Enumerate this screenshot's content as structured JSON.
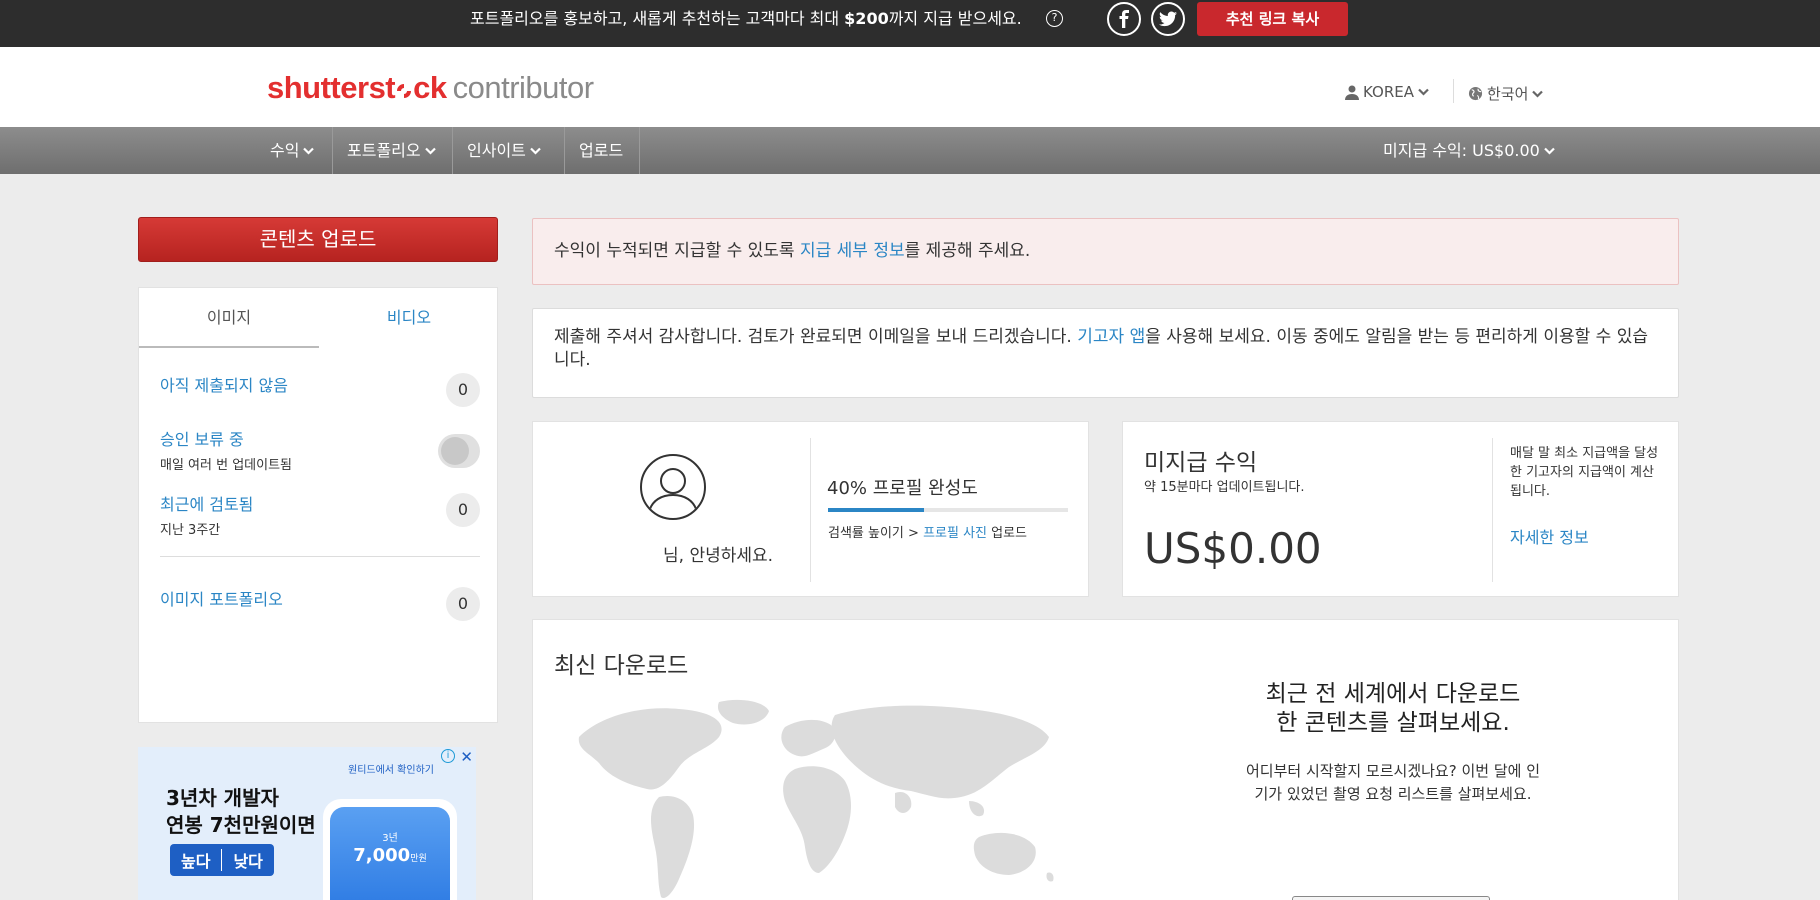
{
  "promo": {
    "text_before": "포트폴리오를 홍보하고, 새롭게 추천하는 고객마다 최대 ",
    "amount": "$200",
    "text_after": "까지 지급 받으세요.",
    "help": "?",
    "copy_button": "추천 링크 복사"
  },
  "header": {
    "logo_brand_1": "shutterst",
    "logo_brand_2": "ck",
    "logo_suffix": "contributor",
    "account": "KOREA",
    "language": "한국어"
  },
  "nav": {
    "items": [
      {
        "label": "수익"
      },
      {
        "label": "포트폴리오"
      },
      {
        "label": "인사이트"
      },
      {
        "label": "업로드"
      }
    ],
    "unpaid": "미지급 수익: US$0.00"
  },
  "sidebar": {
    "upload_button": "콘텐츠 업로드",
    "tabs": [
      "이미지",
      "비디오"
    ],
    "statuses": [
      {
        "title": "아직 제출되지 않음",
        "sub": "",
        "count": "0"
      },
      {
        "title": "승인 보류 중",
        "sub": "매일 여러 번 업데이트됨",
        "count": ""
      },
      {
        "title": "최근에 검토됨",
        "sub": "지난 3주간",
        "count": "0"
      },
      {
        "title": "이미지 포트폴리오",
        "sub": "",
        "count": "0"
      }
    ]
  },
  "ad": {
    "headline_1": "3년차 개발자",
    "headline_2": "연봉 7천만원이면",
    "btn_high": "높다",
    "btn_low": "낮다",
    "top_label": "원티드에서 확인하기",
    "screen_label": "3년",
    "screen_value": "7,000",
    "screen_unit": "만원",
    "info": "i",
    "close": "✕"
  },
  "alerts": {
    "payout_before": "수익이 누적되면 지급할 수 있도록 ",
    "payout_link": "지급 세부 정보",
    "payout_after": "를 제공해 주세요.",
    "thanks_before": "제출해 주셔서 감사합니다. 검토가 완료되면 이메일을 보내 드리겠습니다. ",
    "thanks_link": "기고자 앱",
    "thanks_after": "을 사용해 보세요. 이동 중에도 알림을 받는 등 편리하게 이용할 수 있습니다."
  },
  "profile": {
    "greeting": "님, 안녕하세요.",
    "completion": "40% 프로필 완성도",
    "completion_value": 0.4,
    "hint_before": "검색률 높이기 > ",
    "hint_link": "프로필 사진",
    "hint_after": " 업로드"
  },
  "earnings": {
    "title": "미지급 수익",
    "subtitle": "약 15분마다 업데이트됩니다.",
    "amount": "US$0.00",
    "note": "매달 말 최소 지급액을 달성한 기고자의 지급액이 계산됩니다.",
    "more_link": "자세한 정보"
  },
  "downloads": {
    "title": "최신 다운로드",
    "heading_1": "최근 전 세계에서 다운로드",
    "heading_2": "한 콘텐츠를 살펴보세요.",
    "body": "어디부터 시작할지 모르시겠나요? 이번 달에 인기가 있었던 촬영 요청 리스트를 살펴보세요."
  },
  "colors": {
    "accent_red": "#c9282d",
    "link_blue": "#2b86c5",
    "nav_gray": "#7d7d7d",
    "top_bar": "#2d2d2d"
  }
}
